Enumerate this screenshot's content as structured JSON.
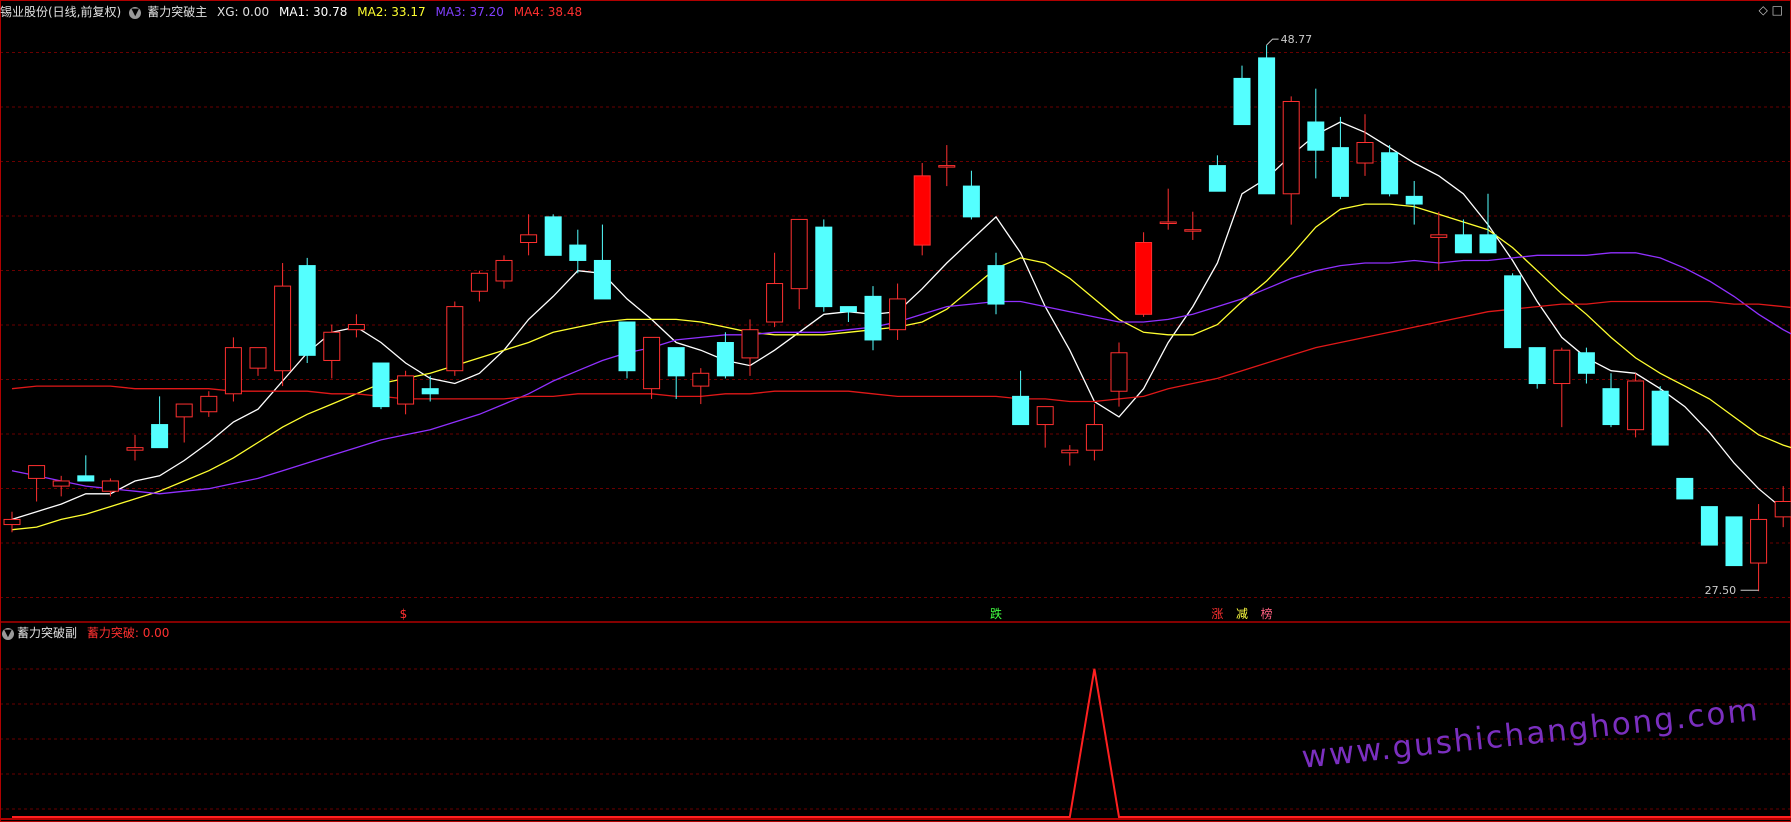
{
  "header": {
    "stock_name": "锡业股份(日线,前复权)",
    "indicator_name": "蓄力突破主",
    "xg": "XG: 0.00",
    "ma1": "MA1: 30.78",
    "ma2": "MA2: 33.17",
    "ma3": "MA3: 37.20",
    "ma4": "MA4: 38.48"
  },
  "sub_header": {
    "indicator_name": "蓄力突破副",
    "value_label": "蓄力突破: 0.00"
  },
  "watermark": "www.gushichanghong.com",
  "colors": {
    "up": "#ff3030",
    "up_fill": "#ff0000",
    "down": "#54ffff",
    "ma1": "#ffffff",
    "ma2": "#ffff30",
    "ma3": "#9030ff",
    "ma4": "#e01818",
    "grid": "#6a0000",
    "border": "#b00000"
  },
  "chart_data": [
    {
      "type": "candlestick",
      "title": "",
      "y_range": [
        26.3,
        49.7
      ],
      "max_label": "48.77",
      "min_label": "27.50",
      "marker_labels": [
        {
          "text": "$",
          "index": 16,
          "color": "#ff3030"
        },
        {
          "text": "跌",
          "index": 40,
          "color": "#40ff40"
        },
        {
          "text": "涨",
          "index": 49,
          "color": "#ff3030"
        },
        {
          "text": "减",
          "index": 50,
          "color": "#ffff40"
        },
        {
          "text": "榜",
          "index": 51,
          "color": "#ff6080"
        }
      ],
      "candles": [
        {
          "o": 30.1,
          "h": 30.6,
          "l": 29.8,
          "c": 30.3,
          "filled": false
        },
        {
          "o": 31.9,
          "h": 32.4,
          "l": 31.0,
          "c": 32.4,
          "filled": false
        },
        {
          "o": 31.6,
          "h": 32.0,
          "l": 31.2,
          "c": 31.8,
          "filled": false
        },
        {
          "o": 32.0,
          "h": 32.8,
          "l": 31.8,
          "c": 31.8,
          "filled": false
        },
        {
          "o": 31.4,
          "h": 31.9,
          "l": 31.2,
          "c": 31.8,
          "filled": false
        },
        {
          "o": 33.0,
          "h": 33.6,
          "l": 32.6,
          "c": 33.1,
          "filled": false
        },
        {
          "o": 34.0,
          "h": 35.1,
          "l": 33.3,
          "c": 33.1,
          "filled": false
        },
        {
          "o": 34.3,
          "h": 34.8,
          "l": 33.3,
          "c": 34.8,
          "filled": false
        },
        {
          "o": 34.5,
          "h": 35.3,
          "l": 34.3,
          "c": 35.1,
          "filled": false
        },
        {
          "o": 35.2,
          "h": 37.4,
          "l": 34.9,
          "c": 37.0,
          "filled": false
        },
        {
          "o": 36.2,
          "h": 37.0,
          "l": 35.9,
          "c": 37.0,
          "filled": false
        },
        {
          "o": 36.1,
          "h": 40.3,
          "l": 35.5,
          "c": 39.4,
          "filled": false
        },
        {
          "o": 40.2,
          "h": 40.5,
          "l": 36.4,
          "c": 36.7,
          "filled": false
        },
        {
          "o": 36.5,
          "h": 37.9,
          "l": 35.8,
          "c": 37.6,
          "filled": false
        },
        {
          "o": 37.7,
          "h": 38.3,
          "l": 37.4,
          "c": 37.9,
          "filled": false
        },
        {
          "o": 36.4,
          "h": 36.4,
          "l": 34.6,
          "c": 34.7,
          "filled": false
        },
        {
          "o": 34.8,
          "h": 36.1,
          "l": 34.4,
          "c": 35.9,
          "filled": false
        },
        {
          "o": 35.4,
          "h": 35.9,
          "l": 34.9,
          "c": 35.2,
          "filled": false
        },
        {
          "o": 36.1,
          "h": 38.8,
          "l": 35.9,
          "c": 38.6,
          "filled": false
        },
        {
          "o": 39.2,
          "h": 40.0,
          "l": 38.8,
          "c": 39.9,
          "filled": false
        },
        {
          "o": 39.6,
          "h": 40.6,
          "l": 39.3,
          "c": 40.4,
          "filled": false
        },
        {
          "o": 41.1,
          "h": 42.2,
          "l": 40.6,
          "c": 41.4,
          "filled": false
        },
        {
          "o": 42.1,
          "h": 42.2,
          "l": 40.6,
          "c": 40.6,
          "filled": false
        },
        {
          "o": 41.0,
          "h": 41.6,
          "l": 39.9,
          "c": 40.4,
          "filled": false
        },
        {
          "o": 40.4,
          "h": 41.8,
          "l": 39.1,
          "c": 38.9,
          "filled": false
        },
        {
          "o": 38.0,
          "h": 38.0,
          "l": 35.8,
          "c": 36.1,
          "filled": false
        },
        {
          "o": 35.4,
          "h": 37.4,
          "l": 35.0,
          "c": 37.4,
          "filled": false
        },
        {
          "o": 37.0,
          "h": 37.0,
          "l": 35.0,
          "c": 35.9,
          "filled": false
        },
        {
          "o": 35.5,
          "h": 36.2,
          "l": 34.8,
          "c": 36.0,
          "filled": false
        },
        {
          "o": 37.2,
          "h": 37.6,
          "l": 35.8,
          "c": 35.9,
          "filled": false
        },
        {
          "o": 36.6,
          "h": 38.1,
          "l": 35.9,
          "c": 37.7,
          "filled": false
        },
        {
          "o": 38.0,
          "h": 40.7,
          "l": 37.8,
          "c": 39.5,
          "filled": false
        },
        {
          "o": 39.3,
          "h": 42.0,
          "l": 38.5,
          "c": 42.0,
          "filled": false
        },
        {
          "o": 41.7,
          "h": 42.0,
          "l": 38.4,
          "c": 38.6,
          "filled": false
        },
        {
          "o": 38.6,
          "h": 38.6,
          "l": 38.0,
          "c": 38.4,
          "filled": false
        },
        {
          "o": 39.0,
          "h": 39.4,
          "l": 36.9,
          "c": 37.3,
          "filled": false
        },
        {
          "o": 37.7,
          "h": 39.5,
          "l": 37.3,
          "c": 38.9,
          "filled": false
        },
        {
          "o": 41.0,
          "h": 44.2,
          "l": 40.6,
          "c": 43.7,
          "filled": true
        },
        {
          "o": 44.1,
          "h": 44.9,
          "l": 43.3,
          "c": 44.1,
          "filled": false
        },
        {
          "o": 43.3,
          "h": 43.9,
          "l": 42.0,
          "c": 42.1,
          "filled": false
        },
        {
          "o": 40.2,
          "h": 40.7,
          "l": 38.3,
          "c": 38.7,
          "filled": false
        },
        {
          "o": 35.1,
          "h": 36.1,
          "l": 34.0,
          "c": 34.0,
          "filled": false
        },
        {
          "o": 34.0,
          "h": 34.7,
          "l": 33.1,
          "c": 34.7,
          "filled": false
        },
        {
          "o": 32.9,
          "h": 33.2,
          "l": 32.4,
          "c": 33.0,
          "filled": false
        },
        {
          "o": 33.0,
          "h": 34.8,
          "l": 32.6,
          "c": 34.0,
          "filled": false
        },
        {
          "o": 35.3,
          "h": 37.2,
          "l": 34.7,
          "c": 36.8,
          "filled": false
        },
        {
          "o": 38.3,
          "h": 41.5,
          "l": 38.2,
          "c": 41.1,
          "filled": true
        },
        {
          "o": 41.9,
          "h": 43.2,
          "l": 41.6,
          "c": 41.9,
          "filled": false
        },
        {
          "o": 41.6,
          "h": 42.3,
          "l": 41.2,
          "c": 41.6,
          "filled": false
        },
        {
          "o": 44.1,
          "h": 44.5,
          "l": 43.7,
          "c": 43.1,
          "filled": false
        },
        {
          "o": 47.5,
          "h": 48.0,
          "l": 45.9,
          "c": 45.7,
          "filled": true
        },
        {
          "o": 48.3,
          "h": 48.8,
          "l": 43.0,
          "c": 43.0,
          "filled": false
        },
        {
          "o": 43.0,
          "h": 46.8,
          "l": 41.8,
          "c": 46.6,
          "filled": false
        },
        {
          "o": 45.8,
          "h": 47.1,
          "l": 43.6,
          "c": 44.7,
          "filled": false
        },
        {
          "o": 44.8,
          "h": 46.0,
          "l": 42.8,
          "c": 42.9,
          "filled": false
        },
        {
          "o": 44.2,
          "h": 46.1,
          "l": 43.7,
          "c": 45.0,
          "filled": false
        },
        {
          "o": 44.6,
          "h": 44.9,
          "l": 42.9,
          "c": 43.0,
          "filled": false
        },
        {
          "o": 42.9,
          "h": 43.5,
          "l": 41.8,
          "c": 42.6,
          "filled": false
        },
        {
          "o": 41.3,
          "h": 42.3,
          "l": 40.0,
          "c": 41.4,
          "filled": false
        },
        {
          "o": 41.4,
          "h": 42.0,
          "l": 40.7,
          "c": 40.7,
          "filled": false
        },
        {
          "o": 41.4,
          "h": 43.0,
          "l": 40.7,
          "c": 40.7,
          "filled": false
        },
        {
          "o": 39.8,
          "h": 39.9,
          "l": 37.0,
          "c": 37.0,
          "filled": false
        },
        {
          "o": 37.0,
          "h": 37.0,
          "l": 35.4,
          "c": 35.6,
          "filled": false
        },
        {
          "o": 35.6,
          "h": 37.0,
          "l": 33.9,
          "c": 36.9,
          "filled": false
        },
        {
          "o": 36.8,
          "h": 37.0,
          "l": 35.6,
          "c": 36.0,
          "filled": false
        },
        {
          "o": 35.4,
          "h": 36.0,
          "l": 33.9,
          "c": 34.0,
          "filled": false
        },
        {
          "o": 33.8,
          "h": 36.0,
          "l": 33.5,
          "c": 35.7,
          "filled": false
        },
        {
          "o": 35.3,
          "h": 35.5,
          "l": 33.2,
          "c": 33.2,
          "filled": false
        },
        {
          "o": 31.9,
          "h": 31.9,
          "l": 31.1,
          "c": 31.1,
          "filled": false
        },
        {
          "o": 30.8,
          "h": 30.8,
          "l": 29.3,
          "c": 29.3,
          "filled": false
        },
        {
          "o": 30.4,
          "h": 30.4,
          "l": 28.5,
          "c": 28.5,
          "filled": false
        },
        {
          "o": 28.6,
          "h": 30.9,
          "l": 27.5,
          "c": 30.3,
          "filled": false
        },
        {
          "o": 30.4,
          "h": 31.6,
          "l": 30.0,
          "c": 31.0,
          "filled": false
        }
      ],
      "series": [
        {
          "name": "MA1",
          "color": "#ffffff",
          "values": [
            30.3,
            30.6,
            30.9,
            31.3,
            31.3,
            31.8,
            32.0,
            32.6,
            33.3,
            34.1,
            34.6,
            35.7,
            36.8,
            37.6,
            37.8,
            37.2,
            36.4,
            35.8,
            35.6,
            36.0,
            36.9,
            38.1,
            39.0,
            40.0,
            39.9,
            38.9,
            38.1,
            37.2,
            36.9,
            36.5,
            36.3,
            36.9,
            37.6,
            38.3,
            38.4,
            38.3,
            38.4,
            39.3,
            40.3,
            41.2,
            42.1,
            40.7,
            38.6,
            36.9,
            34.9,
            34.3,
            35.4,
            37.2,
            38.6,
            40.3,
            43.0,
            43.6,
            44.5,
            45.3,
            45.8,
            45.4,
            44.8,
            44.2,
            43.7,
            43.0,
            41.8,
            40.4,
            38.8,
            37.4,
            36.6,
            36.1,
            36.0,
            35.4,
            34.7,
            33.7,
            32.5,
            31.5,
            30.7,
            30.6
          ]
        },
        {
          "name": "MA2",
          "color": "#ffff30",
          "values": [
            29.9,
            30.0,
            30.3,
            30.5,
            30.8,
            31.1,
            31.4,
            31.8,
            32.2,
            32.7,
            33.3,
            33.9,
            34.4,
            34.8,
            35.2,
            35.6,
            35.8,
            36.0,
            36.3,
            36.6,
            36.9,
            37.2,
            37.6,
            37.8,
            38.0,
            38.1,
            38.1,
            38.1,
            38.0,
            37.8,
            37.6,
            37.5,
            37.5,
            37.5,
            37.6,
            37.7,
            37.8,
            38.0,
            38.5,
            39.3,
            40.1,
            40.5,
            40.3,
            39.7,
            38.9,
            38.1,
            37.6,
            37.5,
            37.5,
            37.9,
            38.8,
            39.6,
            40.6,
            41.7,
            42.4,
            42.6,
            42.6,
            42.5,
            42.2,
            41.9,
            41.6,
            40.9,
            40.0,
            39.1,
            38.3,
            37.4,
            36.6,
            36.0,
            35.5,
            35.0,
            34.3,
            33.6,
            33.2,
            32.9
          ]
        },
        {
          "name": "MA3",
          "color": "#9030ff",
          "values": [
            32.2,
            32.0,
            31.8,
            31.6,
            31.5,
            31.4,
            31.3,
            31.4,
            31.5,
            31.7,
            31.9,
            32.2,
            32.5,
            32.8,
            33.1,
            33.4,
            33.6,
            33.8,
            34.1,
            34.4,
            34.8,
            35.2,
            35.7,
            36.1,
            36.5,
            36.8,
            37.0,
            37.3,
            37.4,
            37.5,
            37.5,
            37.6,
            37.6,
            37.6,
            37.7,
            37.8,
            38.0,
            38.3,
            38.6,
            38.7,
            38.8,
            38.8,
            38.6,
            38.4,
            38.2,
            38.0,
            38.0,
            38.1,
            38.3,
            38.6,
            38.9,
            39.3,
            39.7,
            40.0,
            40.2,
            40.3,
            40.3,
            40.4,
            40.3,
            40.4,
            40.4,
            40.5,
            40.6,
            40.6,
            40.6,
            40.7,
            40.7,
            40.5,
            40.1,
            39.6,
            39.0,
            38.3,
            37.7,
            37.2
          ]
        },
        {
          "name": "MA4",
          "color": "#e01818",
          "values": [
            35.4,
            35.5,
            35.5,
            35.5,
            35.5,
            35.4,
            35.4,
            35.4,
            35.4,
            35.3,
            35.3,
            35.3,
            35.3,
            35.2,
            35.2,
            35.1,
            35.0,
            35.0,
            35.0,
            35.0,
            35.0,
            35.1,
            35.1,
            35.2,
            35.2,
            35.2,
            35.2,
            35.1,
            35.1,
            35.2,
            35.2,
            35.3,
            35.3,
            35.3,
            35.3,
            35.2,
            35.1,
            35.1,
            35.1,
            35.1,
            35.1,
            35.0,
            35.0,
            34.9,
            34.9,
            35.0,
            35.1,
            35.4,
            35.6,
            35.8,
            36.1,
            36.4,
            36.7,
            37.0,
            37.2,
            37.4,
            37.6,
            37.8,
            38.0,
            38.2,
            38.4,
            38.5,
            38.6,
            38.7,
            38.7,
            38.8,
            38.8,
            38.8,
            38.8,
            38.8,
            38.7,
            38.7,
            38.6,
            38.5
          ]
        }
      ]
    },
    {
      "type": "line",
      "title": "",
      "y_range": [
        0,
        1.1
      ],
      "series": [
        {
          "name": "蓄力突破",
          "color": "#ff2020",
          "values": [
            0,
            0,
            0,
            0,
            0,
            0,
            0,
            0,
            0,
            0,
            0,
            0,
            0,
            0,
            0,
            0,
            0,
            0,
            0,
            0,
            0,
            0,
            0,
            0,
            0,
            0,
            0,
            0,
            0,
            0,
            0,
            0,
            0,
            0,
            0,
            0,
            0,
            0,
            0,
            0,
            0,
            0,
            0,
            0,
            1,
            0,
            0,
            0,
            0,
            0,
            0,
            0,
            0,
            0,
            0,
            0,
            0,
            0,
            0,
            0,
            0,
            0,
            0,
            0,
            0,
            0,
            0,
            0,
            0,
            0,
            0,
            0,
            0,
            0
          ]
        }
      ]
    }
  ]
}
